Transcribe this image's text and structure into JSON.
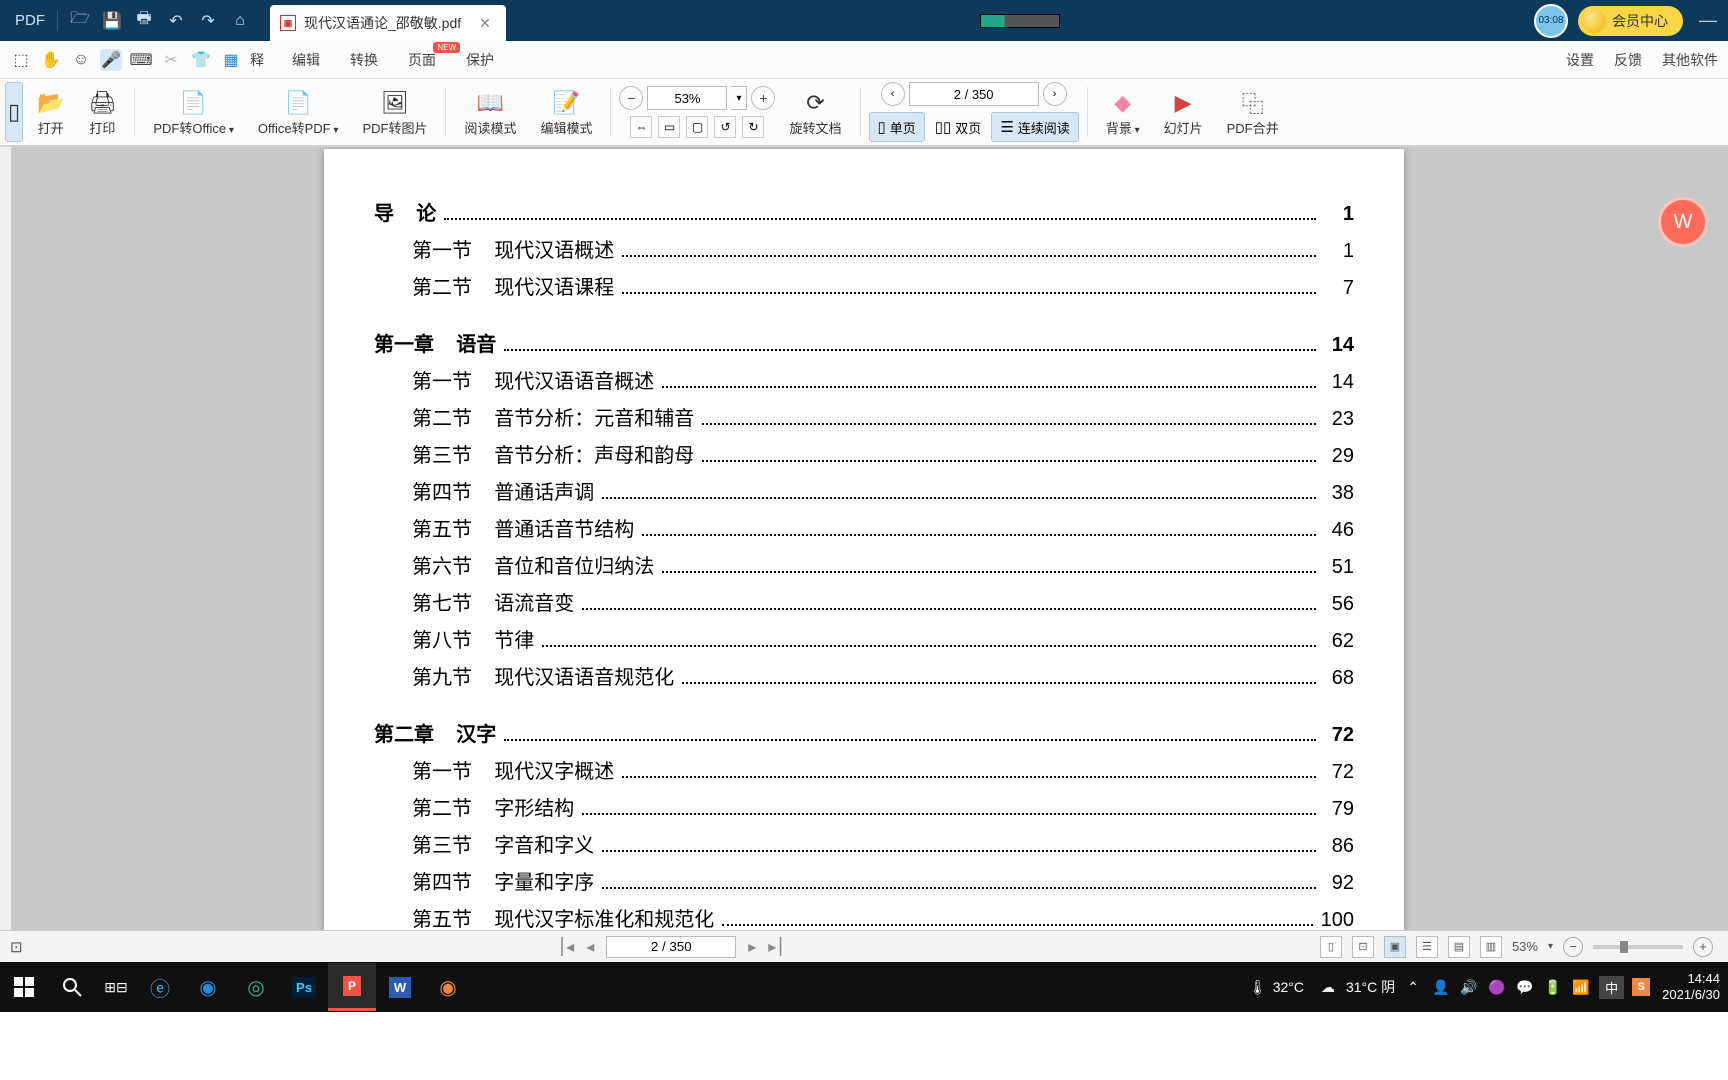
{
  "titlebar": {
    "pdf_label": "PDF",
    "tab_title": "现代汉语通论_邵敬敏.pdf",
    "timer": "03:08",
    "member": "会员中心"
  },
  "toolrow2": {
    "menu_annotate": "释",
    "menu_edit": "编辑",
    "menu_convert": "转换",
    "menu_page": "页面",
    "menu_page_badge": "NEW",
    "menu_protect": "保护",
    "right_settings": "设置",
    "right_feedback": "反馈",
    "right_other": "其他软件"
  },
  "ribbon": {
    "open": "打开",
    "print": "打印",
    "pdf2office": "PDF转Office",
    "office2pdf": "Office转PDF",
    "pdf2img": "PDF转图片",
    "readmode": "阅读模式",
    "editmode": "编辑模式",
    "zoom_value": "53%",
    "rotate": "旋转文档",
    "page_value": "2 / 350",
    "single": "单页",
    "double": "双页",
    "continuous": "连续阅读",
    "bg": "背景",
    "slide": "幻灯片",
    "merge": "PDF合并"
  },
  "toc": [
    {
      "type": "chapter",
      "prefix": "导    论",
      "title": "",
      "page": "1"
    },
    {
      "type": "section",
      "prefix": "第一节",
      "title": "现代汉语概述",
      "page": "1"
    },
    {
      "type": "section",
      "prefix": "第二节",
      "title": "现代汉语课程",
      "page": "7"
    },
    {
      "type": "chapter",
      "prefix": "第一章    语音",
      "title": "",
      "page": "14"
    },
    {
      "type": "section",
      "prefix": "第一节",
      "title": "现代汉语语音概述",
      "page": "14"
    },
    {
      "type": "section",
      "prefix": "第二节",
      "title": "音节分析：元音和辅音",
      "page": "23"
    },
    {
      "type": "section",
      "prefix": "第三节",
      "title": "音节分析：声母和韵母",
      "page": "29"
    },
    {
      "type": "section",
      "prefix": "第四节",
      "title": "普通话声调",
      "page": "38"
    },
    {
      "type": "section",
      "prefix": "第五节",
      "title": "普通话音节结构",
      "page": "46"
    },
    {
      "type": "section",
      "prefix": "第六节",
      "title": "音位和音位归纳法",
      "page": "51"
    },
    {
      "type": "section",
      "prefix": "第七节",
      "title": "语流音变",
      "page": "56"
    },
    {
      "type": "section",
      "prefix": "第八节",
      "title": "节律",
      "page": "62"
    },
    {
      "type": "section",
      "prefix": "第九节",
      "title": "现代汉语语音规范化",
      "page": "68"
    },
    {
      "type": "chapter",
      "prefix": "第二章    汉字",
      "title": "",
      "page": "72"
    },
    {
      "type": "section",
      "prefix": "第一节",
      "title": "现代汉字概述",
      "page": "72"
    },
    {
      "type": "section",
      "prefix": "第二节",
      "title": "字形结构",
      "page": "79"
    },
    {
      "type": "section",
      "prefix": "第三节",
      "title": "字音和字义",
      "page": "86"
    },
    {
      "type": "section",
      "prefix": "第四节",
      "title": "字量和字序",
      "page": "92"
    },
    {
      "type": "section",
      "prefix": "第五节",
      "title": "现代汉字标准化和规范化",
      "page": "100"
    }
  ],
  "statusbar": {
    "page": "2 / 350",
    "zoom": "53%"
  },
  "taskbar": {
    "temp": "32°C",
    "weather_temp": "31°C 阴",
    "ime": "中",
    "time": "14:44",
    "date": "2021/6/30"
  }
}
